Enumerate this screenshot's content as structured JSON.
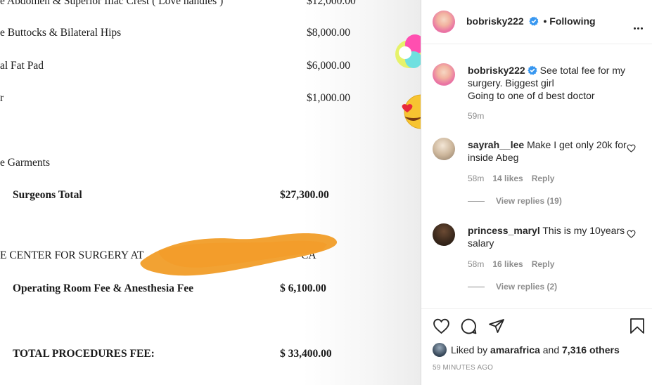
{
  "document": {
    "lines": [
      {
        "label": "e Abdomen & Superior Iliac Crest ( Love handles )",
        "amount": "$12,000.00"
      },
      {
        "label": "e Buttocks & Bilateral Hips",
        "amount": "$8,000.00"
      },
      {
        "label": "al Fat Pad",
        "amount": "$6,000.00"
      },
      {
        "label": "r",
        "amount": "$1,000.00"
      },
      {
        "label": "e Garments",
        "amount": ""
      }
    ],
    "surgeons_total_label": "Surgeons Total",
    "surgeons_total_amount": "$27,300.00",
    "center_label": "E CENTER FOR SURGERY AT",
    "center_suffix": "CA",
    "or_fee_label": "Operating Room Fee & Anesthesia Fee",
    "or_fee_amount": "$ 6,100.00",
    "total_label": "TOTAL PROCEDURES FEE:",
    "total_amount": "$ 33,400.00"
  },
  "post": {
    "author": "bobrisky222",
    "follow_status": "• Following",
    "caption_line1": "See total fee for my surgery. Biggest girl",
    "caption_line2": "Going to one of d best doctor",
    "caption_time": "59m"
  },
  "comments": [
    {
      "user": "sayrah__lee",
      "text": "Make I get only 20k for inside Abeg",
      "time": "58m",
      "likes": "14 likes",
      "reply": "Reply",
      "view_replies": "View replies (19)"
    },
    {
      "user": "princess_maryl",
      "text": "This is my 10years salary",
      "time": "58m",
      "likes": "16 likes",
      "reply": "Reply",
      "view_replies": "View replies (2)"
    }
  ],
  "footer": {
    "liked_by_prefix": "Liked by",
    "liked_by_user": "amarafrica",
    "liked_by_and": "and",
    "liked_by_others": "7,316 others",
    "time_ago": "59 MINUTES AGO"
  },
  "colors": {
    "verified": "#3897f0",
    "muted": "#8e8e8e",
    "text": "#262626",
    "scribble": "#f2a233"
  },
  "icons": [
    "verified-badge-icon",
    "more-options-icon",
    "heart-icon",
    "comment-icon",
    "share-icon",
    "bookmark-icon"
  ]
}
